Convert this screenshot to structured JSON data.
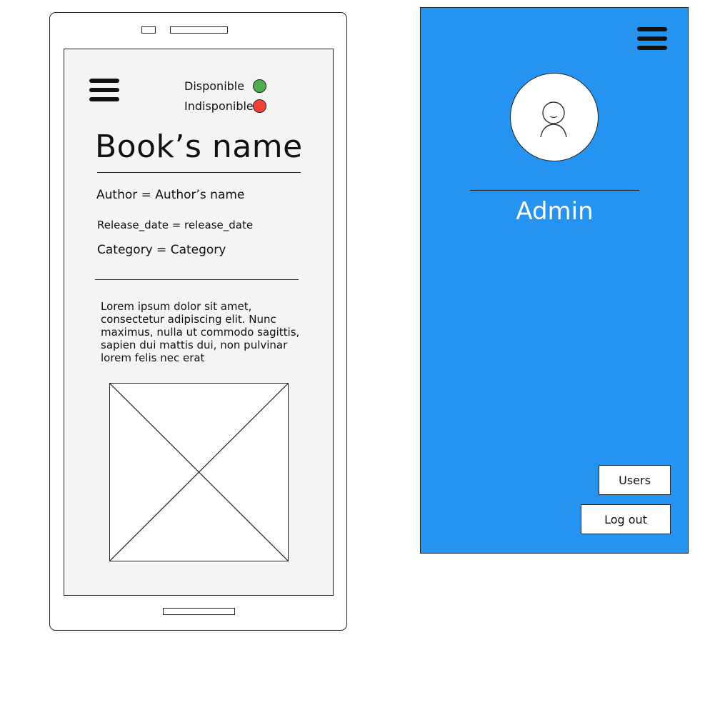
{
  "book_screen": {
    "status": {
      "available_label": "Disponible",
      "unavailable_label": "Indisponible",
      "available_color": "#4caf50",
      "unavailable_color": "#f44336"
    },
    "title": "Book’s name",
    "author_line": "Author = Author’s name",
    "release_line": "Release_date = release_date",
    "category_line": "Category = Category",
    "description": "Lorem ipsum dolor sit amet, consectetur adipiscing elit. Nunc maximus, nulla ut commodo sagittis, sapien dui mattis dui, non pulvinar lorem felis nec erat",
    "icons": {
      "menu": "hamburger-menu-icon",
      "image": "image-placeholder-icon"
    }
  },
  "admin_panel": {
    "background_color": "#2493f2",
    "user_name": "Admin",
    "buttons": {
      "users": "Users",
      "logout": "Log out"
    },
    "icons": {
      "menu": "hamburger-menu-icon",
      "avatar": "user-avatar-icon"
    }
  }
}
